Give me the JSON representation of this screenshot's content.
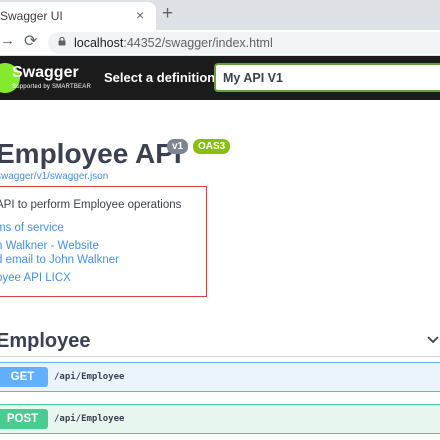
{
  "browser": {
    "tab_title": "Swagger UI",
    "close_glyph": "×",
    "new_tab_glyph": "+",
    "forward_glyph": "→",
    "reload_glyph": "⟳",
    "url_host": "localhost",
    "url_rest": ":44352/swagger/index.html"
  },
  "topbar": {
    "logo_text": "Swagger",
    "logo_sub": "Supported by SMARTBEAR",
    "definition_label": "Select a definition",
    "definition_value": "My API V1"
  },
  "info": {
    "title": "Employee API",
    "version": "v1",
    "oas": "OAS3",
    "spec_link": "swagger/v1/swagger.json",
    "description": "API to perform Employee operations",
    "terms": "ms of service",
    "contact_site": "n Walkner - Website",
    "contact_email": "d email to John Walkner",
    "license": "oyee API LICX"
  },
  "operations": {
    "tag": "Employee",
    "items": [
      {
        "method": "GET",
        "path": "/api/Employee"
      },
      {
        "method": "POST",
        "path": "/api/Employee"
      }
    ]
  }
}
